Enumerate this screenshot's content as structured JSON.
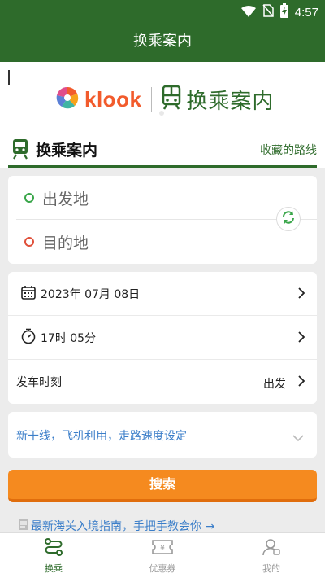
{
  "status_bar": {
    "time": "4:57",
    "icons": [
      "wifi-icon",
      "no-sim-icon",
      "battery-charging-icon"
    ]
  },
  "app_bar": {
    "title": "换乘案内"
  },
  "banner": {
    "brand": "klook",
    "product": "换乘案内"
  },
  "section": {
    "title": "换乘案内",
    "favorites_link": "收藏的路线"
  },
  "route": {
    "from_placeholder": "出发地",
    "to_placeholder": "目的地"
  },
  "options": {
    "date": "2023年 07月 08日",
    "time": "17时 05分",
    "mode_label": "发车时刻",
    "mode_value": "出发"
  },
  "extra_settings": {
    "label": "新干线，飞机利用，走路速度设定"
  },
  "search_button": {
    "label": "搜索"
  },
  "news": {
    "text": "最新海关入境指南，手把手教会你 →"
  },
  "tabs": [
    {
      "label": "换乘",
      "icon": "route-icon",
      "active": true
    },
    {
      "label": "优惠券",
      "icon": "coupon-icon",
      "active": false
    },
    {
      "label": "我的",
      "icon": "profile-icon",
      "active": false
    }
  ],
  "colors": {
    "primary_green": "#2e6b2b",
    "accent_orange": "#f58a1f",
    "link_blue": "#3b7ec9",
    "from_dot": "#3aa64a",
    "to_dot": "#e0513b"
  }
}
